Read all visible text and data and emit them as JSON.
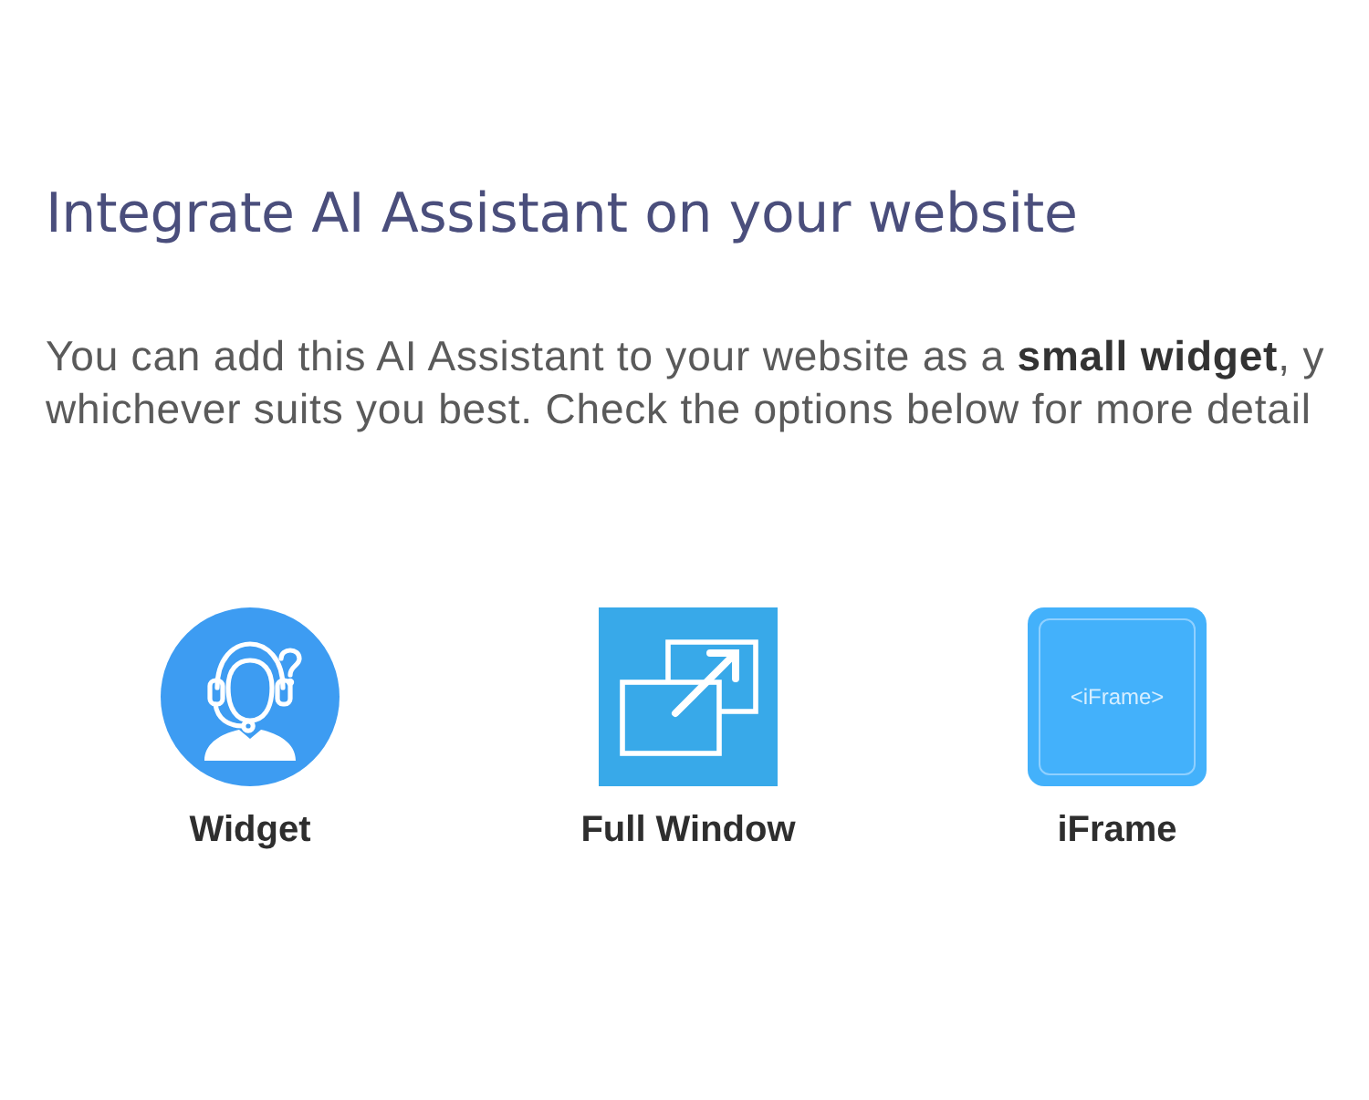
{
  "heading": "Integrate AI Assistant on your website",
  "intro": {
    "lines": [
      "You can add this AI Assistant to your website as a **small widget**, y",
      "whichever suits you best. Check the options below for more detail"
    ]
  },
  "options": [
    {
      "kind": "widget",
      "label": "Widget"
    },
    {
      "kind": "window",
      "label": "Full Window"
    },
    {
      "kind": "iframe",
      "label": "iFrame",
      "tile_text": "<iFrame>"
    }
  ]
}
